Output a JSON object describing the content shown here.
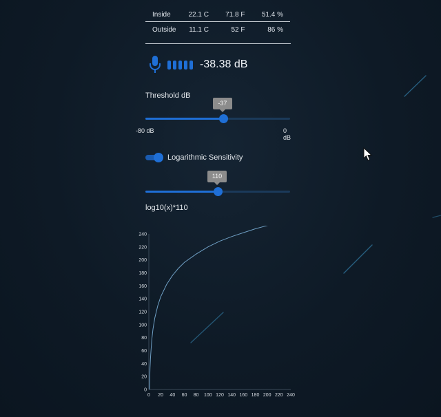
{
  "readings": {
    "rows": [
      {
        "label": "Inside",
        "celsius": "22.1 C",
        "fahrenheit": "71.8 F",
        "humidity": "51.4 %"
      },
      {
        "label": "Outside",
        "celsius": "11.1 C",
        "fahrenheit": "52 F",
        "humidity": "86 %"
      }
    ]
  },
  "audio": {
    "level_text": "-38.38 dB",
    "mic_icon": "microphone-icon",
    "meter_bars": 5
  },
  "threshold": {
    "label": "Threshold dB",
    "value": -37,
    "value_text": "-37",
    "min": -80,
    "max": 0,
    "min_label": "-80 dB",
    "max_label": "0 dB"
  },
  "sensitivity": {
    "toggle_label": "Logarithmic Sensitivity",
    "enabled": true,
    "value": 110,
    "value_text": "110",
    "min": 0,
    "max": 220,
    "formula": "log10(x)*110"
  },
  "colors": {
    "accent": "#1f6fd6",
    "background": "#0e1a26",
    "curve": "#6f9fc4"
  },
  "chart_data": {
    "type": "line",
    "title": "",
    "xlabel": "",
    "ylabel": "",
    "xlim": [
      0,
      240
    ],
    "ylim": [
      0,
      240
    ],
    "x_ticks": [
      0,
      20,
      40,
      60,
      80,
      100,
      120,
      140,
      160,
      180,
      200,
      220,
      240
    ],
    "y_ticks": [
      0,
      20,
      40,
      60,
      80,
      100,
      120,
      140,
      160,
      180,
      200,
      220,
      240
    ],
    "series": [
      {
        "x": [
          1,
          2,
          3,
          5,
          7,
          10,
          15,
          20,
          30,
          40,
          50,
          60,
          80,
          100,
          120,
          140,
          160,
          180,
          200,
          210
        ],
        "y": [
          0,
          33,
          52,
          77,
          93,
          110,
          129,
          143,
          162,
          176,
          187,
          196,
          209,
          220,
          229,
          236,
          242,
          248,
          253,
          255
        ]
      }
    ],
    "grid": false
  }
}
